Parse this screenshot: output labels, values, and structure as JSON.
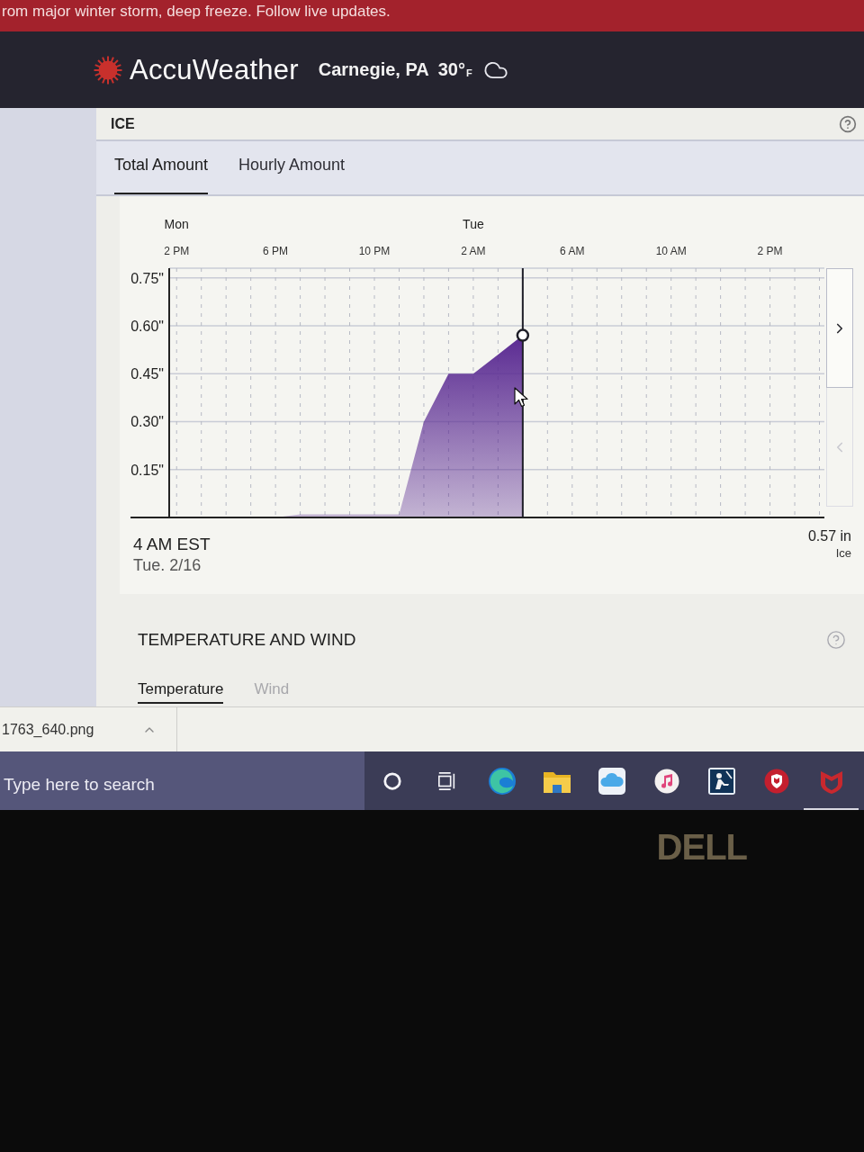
{
  "alert_banner": {
    "text": "rom major winter storm, deep freeze. Follow live updates."
  },
  "header": {
    "brand": "AccuWeather",
    "location": "Carnegie, PA",
    "temperature": "30°",
    "unit": "F"
  },
  "ice": {
    "title": "ICE",
    "tabs": [
      {
        "label": "Total Amount",
        "selected": true
      },
      {
        "label": "Hourly Amount",
        "selected": false
      }
    ],
    "chart_data": {
      "type": "area",
      "categories": [
        "2 PM",
        null,
        null,
        null,
        "6 PM",
        null,
        null,
        null,
        "10 PM",
        null,
        null,
        null,
        "2 AM",
        null,
        null,
        null,
        "6 AM",
        null,
        null,
        null,
        "10 AM",
        null,
        null,
        null,
        "2 PM",
        null,
        null
      ],
      "series": [
        {
          "name": "Ice",
          "color": "#5a2a92",
          "values": [
            0,
            0,
            0,
            0,
            0,
            0.01,
            0.01,
            0.01,
            0.01,
            0.01,
            0.3,
            0.45,
            0.45,
            0.51,
            0.57,
            null,
            null,
            null,
            null,
            null,
            null,
            null,
            null,
            null,
            null,
            null,
            null
          ]
        }
      ],
      "ylim": [
        0,
        0.78
      ],
      "yticks": [
        {
          "value": 0.75,
          "label": "0.75\""
        },
        {
          "value": 0.6,
          "label": "0.60\""
        },
        {
          "value": 0.45,
          "label": "0.45\""
        },
        {
          "value": 0.3,
          "label": "0.30\""
        },
        {
          "value": 0.15,
          "label": "0.15\""
        }
      ],
      "grid": true,
      "annotations": [
        "Mon",
        "Tue"
      ]
    },
    "scroll_buttons": [
      {
        "kind": "next",
        "disabled": false
      },
      {
        "kind": "previous",
        "disabled": true
      }
    ],
    "readout": {
      "time": "4 AM EST",
      "date": "Tue. 2/16",
      "amount": "0.57 in"
    }
  },
  "temperature_and_wind": {
    "title": "TEMPERATURE AND WIND",
    "tabs": [
      {
        "label": "Temperature",
        "selected": true
      },
      {
        "label": "Wind",
        "selected": false
      }
    ]
  },
  "download_bar": {
    "file_name": "1763_640.png"
  },
  "taskbar": {
    "search_placeholder": "Type here to search",
    "apps": [
      {
        "kind": "ring",
        "open": false
      },
      {
        "kind": "task_view",
        "open": false
      },
      {
        "kind": "browser",
        "open": false
      },
      {
        "kind": "folder",
        "open": false
      },
      {
        "kind": "cloud",
        "open": false
      },
      {
        "kind": "music",
        "open": false
      },
      {
        "kind": "reader",
        "open": false
      },
      {
        "kind": "shield",
        "open": false
      },
      {
        "kind": "shield_m",
        "open": true
      }
    ]
  },
  "bezel": {
    "logo": "DELL"
  }
}
